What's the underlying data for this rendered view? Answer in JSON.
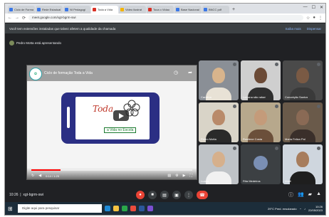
{
  "browser": {
    "tabs": [
      {
        "label": "Ciclo de Forma",
        "color": "#3b78e7"
      },
      {
        "label": "Rede Estadual",
        "color": "#3b78e7"
      },
      {
        "label": "NI Pedagogi",
        "color": "#3b78e7"
      },
      {
        "label": "Toda a Vida",
        "color": "#d93025",
        "active": true
      },
      {
        "label": "Video ilustrat",
        "color": "#f4b400"
      },
      {
        "label": "Toca o Vidao",
        "color": "#d93025"
      },
      {
        "label": "Base Nacional",
        "color": "#3b78e7"
      },
      {
        "label": "BNCC pdf",
        "color": "#3b78e7"
      }
    ],
    "url": "meet.google.com/xgt-bgrm-swi",
    "window_controls": [
      "—",
      "☐",
      "✕"
    ]
  },
  "notice": {
    "text": "Você tem extensões instaladas que talvez afetem a qualidade da chamada",
    "action1": "Saiba mais",
    "action2": "Dispensar"
  },
  "presenter": {
    "text": "Pedro Motta está apresentando"
  },
  "video": {
    "title": "Ciclo de formação Toda a Vida",
    "brand": "Toda",
    "subtitle": "a Vida no Escola",
    "time": "0:14 / 1:25",
    "progress": 0.18,
    "colors": {
      "phone": "#2b2f84",
      "brand": "#c0392b",
      "accent": "#1a7a2e"
    }
  },
  "participants": [
    {
      "name": "Carolina",
      "face": "#d8b48c",
      "body": "#e8e2d6",
      "bg": "#8a8f96"
    },
    {
      "name": "Lorrana são rafael",
      "face": "#6b4a36",
      "body": "#2f2f2f",
      "bg": "#cfcfcf"
    },
    {
      "name": "Conceição Santos",
      "face": "#7a5a44",
      "body": "#3a3a3a",
      "bg": "#4a4a4a"
    },
    {
      "name": "Pedro Motta",
      "face": "#b98a6a",
      "body": "#2a2a2a",
      "bg": "#d9d4c8"
    },
    {
      "name": "Rosilene Costa",
      "face": "#c49b7a",
      "body": "#6b4f3a",
      "bg": "#b7a88c"
    },
    {
      "name": "Maria Feliza Pal",
      "face": "#8a6a55",
      "body": "#3a2f2a",
      "bg": "#6a5a4a"
    },
    {
      "name": "Luana",
      "face": "#d6b08c",
      "body": "#f1f1f1",
      "bg": "#bfc3c7"
    },
    {
      "name": "Rita Medeiros",
      "avatar": "#7a8fb4",
      "bg": "#3c4043"
    },
    {
      "name": "Você",
      "face": "#a77c5c",
      "body": "#1e1e1e",
      "bg": "#cfd6de"
    }
  ],
  "call": {
    "time_code": "10:26",
    "meeting_code": "xgt-bgrm-swi"
  },
  "taskbar": {
    "search_placeholder": "Digite aqui para pesquisar",
    "weather": "29°C  Pred. ensolarado",
    "time": "10:26",
    "date": "22/05/2023"
  }
}
